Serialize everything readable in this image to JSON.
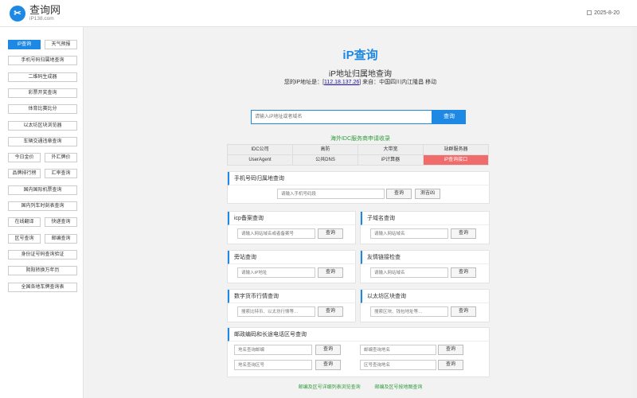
{
  "header": {
    "logo_glyph": "✂",
    "site_name": "查询网",
    "domain": "iP138.com",
    "date": "2025-8-20"
  },
  "sidebar": {
    "rows": [
      [
        "iP查询",
        "天气预报"
      ],
      [
        "手机号码归属地查询"
      ],
      [
        "二维码生成器"
      ],
      [
        "彩票开奖查询"
      ],
      [
        "体育比赛比分"
      ],
      [
        "以太坊区块浏览器"
      ],
      [
        "车辆交通违章查询"
      ],
      [
        "今日金价",
        "外汇牌价"
      ],
      [
        "品牌排行榜",
        "汇率查询"
      ],
      [
        "国内国际机票查询"
      ],
      [
        "国内列车时刻表查询"
      ],
      [
        "在线翻译",
        "快递查询"
      ],
      [
        "区号查询",
        "邮编查询"
      ],
      [
        "身份证号码查询验证"
      ],
      [
        "阴阳转换万年历"
      ],
      [
        "全国各地车牌查询表"
      ]
    ]
  },
  "main": {
    "title": "iP查询",
    "subtitle": "iP地址归属地查询",
    "ip_prefix": "您的iP地址是：[",
    "ip": "112.18.137.26",
    "ip_suffix": "] 来自：中国四川内江隆昌 移动",
    "search": {
      "placeholder": "请输入iP地址或者域名",
      "button": "查询"
    },
    "idc_title": "海外IDC服务商申请收录",
    "idc_cells": [
      "IDC公司",
      "高防",
      "大带宽",
      "站群服务器",
      "UserAgent",
      "公共DNS",
      "iP计算器",
      "iP查询接口"
    ],
    "panels": {
      "phone": {
        "title": "手机号码归属地查询",
        "placeholder": "请输入手机号码段",
        "button": "查询",
        "button2": "测吉凶"
      },
      "icp": {
        "title": "icp备案查询",
        "placeholder": "请输入网站域名或者备案号",
        "button": "查询"
      },
      "subdomain": {
        "title": "子域名查询",
        "placeholder": "请输入网站域名",
        "button": "查询"
      },
      "sibling": {
        "title": "旁站查询",
        "placeholder": "请输入iP地址",
        "button": "查询"
      },
      "friendlink": {
        "title": "友情链接检查",
        "placeholder": "请输入网站域名",
        "button": "查询"
      },
      "crypto": {
        "title": "数字货币行情查询",
        "placeholder": "搜索比特币、以太坊行情等…",
        "button": "查询"
      },
      "eth": {
        "title": "以太坊区块查询",
        "placeholder": "搜索区块、钱包地址等…",
        "button": "查询"
      },
      "postal": {
        "title": "邮政编码和长途电话区号查询",
        "ph1": "地名查询邮编",
        "ph2": "邮编查询地名",
        "ph3": "地名查询区号",
        "ph4": "区号查询地名",
        "button": "查询"
      }
    },
    "footer_links": [
      "邮编及区号详细列表浏览查询",
      "邮编及区号按地图查询"
    ]
  },
  "colors": {
    "accent": "#1e88e5",
    "green": "#2e9d3a",
    "highlight": "#f06b6b"
  }
}
